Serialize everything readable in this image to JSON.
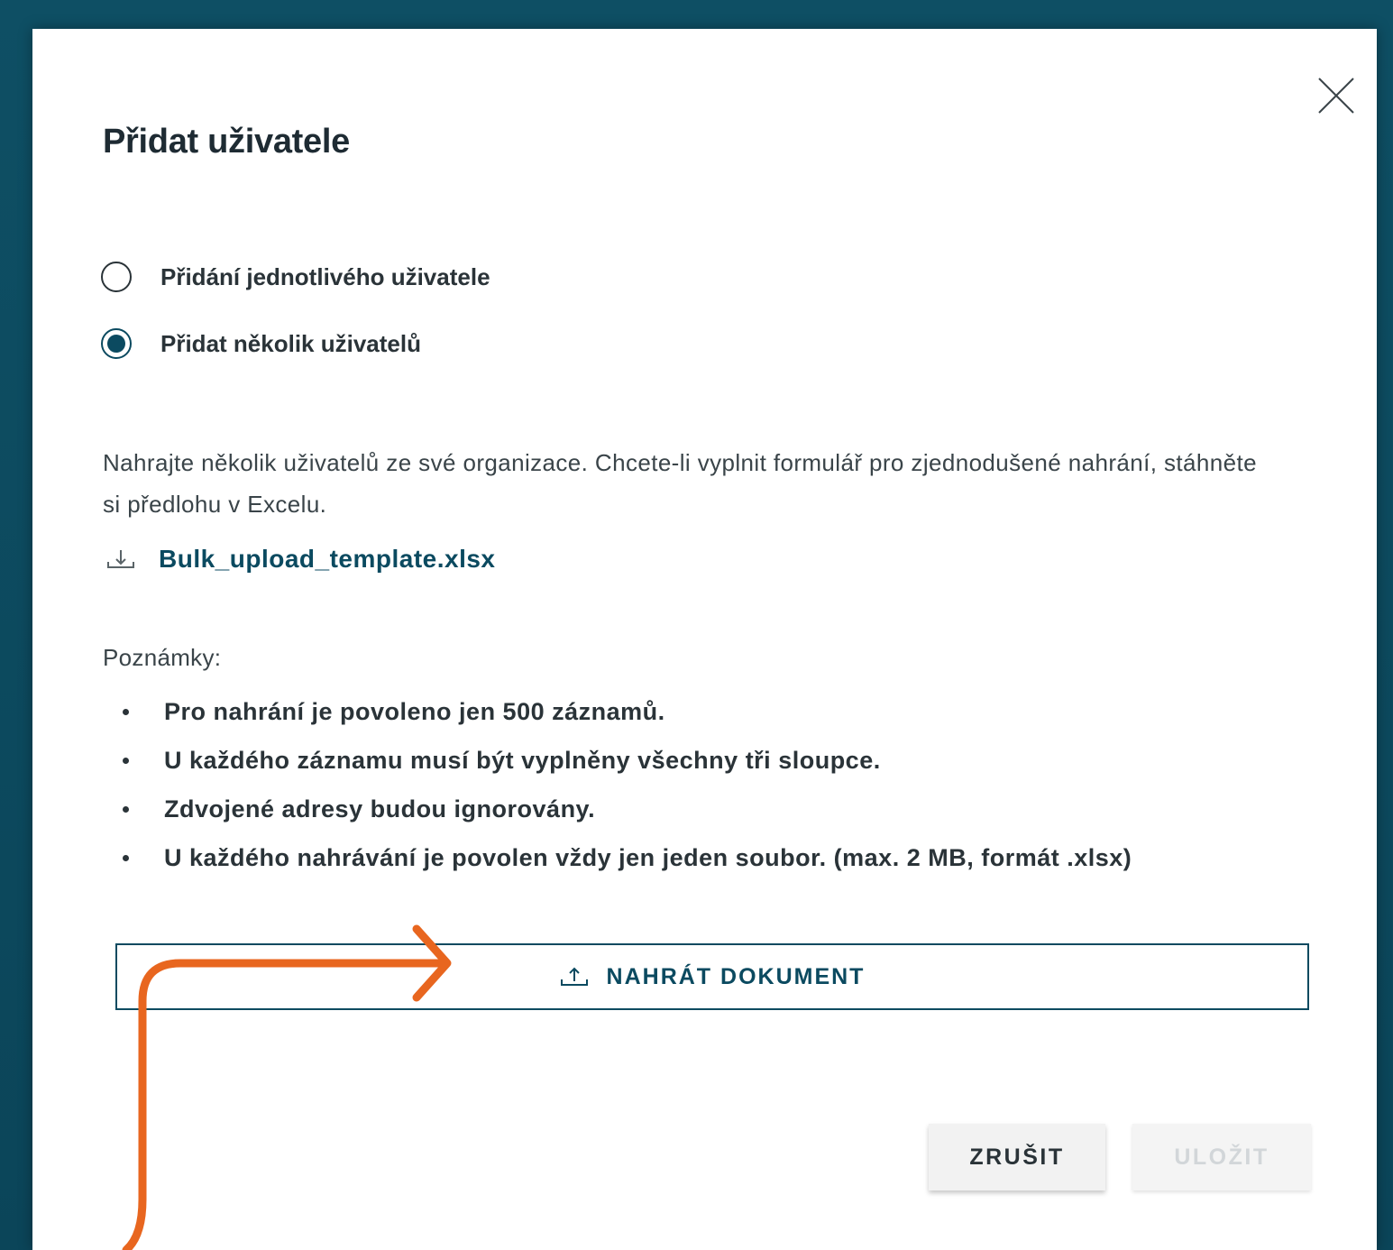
{
  "dialog": {
    "title": "Přidat uživatele",
    "close_label": "×"
  },
  "mode_options": [
    {
      "label": "Přidání jednotlivého uživatele",
      "selected": false
    },
    {
      "label": "Přidat několik uživatelů",
      "selected": true
    }
  ],
  "description": "Nahrajte několik uživatelů ze své organizace. Chcete-li vyplnit formulář pro zjednodušené nahrání, stáhněte si předlohu v Excelu.",
  "template_file": {
    "name": "Bulk_upload_template.xlsx",
    "icon": "download-icon"
  },
  "notes": {
    "title": "Poznámky:",
    "items": [
      "Pro nahrání je povoleno jen 500 záznamů.",
      "U každého záznamu musí být vyplněny všechny tři sloupce.",
      "Zdvojené adresy budou ignorovány.",
      "U každého nahrávání je povolen vždy jen jeden soubor. (max. 2 MB, formát .xlsx)"
    ]
  },
  "upload": {
    "label": "NAHRÁT DOKUMENT",
    "icon": "upload-icon"
  },
  "footer": {
    "cancel_label": "ZRUŠIT",
    "save_label": "ULOŽIT",
    "save_enabled": false
  },
  "colors": {
    "accent": "#0b4a60",
    "annotation": "#e8661f",
    "backdrop": "#0c4a5e"
  }
}
